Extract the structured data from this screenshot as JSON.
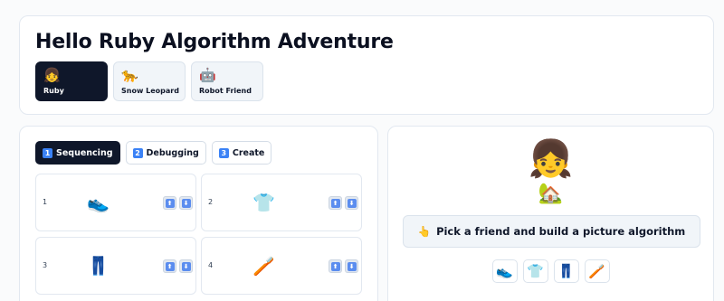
{
  "header": {
    "title": "Hello Ruby Algorithm Adventure",
    "friends": [
      {
        "emoji": "👧",
        "name": "Ruby",
        "active": true
      },
      {
        "emoji": "🐆",
        "name": "Snow Leopard",
        "active": false
      },
      {
        "emoji": "🤖",
        "name": "Robot Friend",
        "active": false
      }
    ]
  },
  "tabs": [
    {
      "num": "1",
      "label": "Sequencing",
      "active": true
    },
    {
      "num": "2",
      "label": "Debugging",
      "active": false
    },
    {
      "num": "3",
      "label": "Create",
      "active": false
    }
  ],
  "steps": [
    {
      "n": "1",
      "emoji": "👟",
      "icon": "sneaker-icon"
    },
    {
      "n": "2",
      "emoji": "👕",
      "icon": "tshirt-icon"
    },
    {
      "n": "3",
      "emoji": "👖",
      "icon": "jeans-icon"
    },
    {
      "n": "4",
      "emoji": "🪥",
      "icon": "toothbrush-icon"
    }
  ],
  "arrows": {
    "up": "⬆",
    "down": "⬇"
  },
  "preview": {
    "character": "👧",
    "scene": "🏡",
    "prompt_icon": "👆",
    "prompt": "Pick a friend and build a picture algorithm",
    "sequence": [
      "👟",
      "👕",
      "👖",
      "🪥"
    ]
  },
  "colors": {
    "active": "#0f172a",
    "accent_key": "#3b82f6",
    "arrow_key": "#5b8def",
    "border": "#e2e8f0"
  }
}
